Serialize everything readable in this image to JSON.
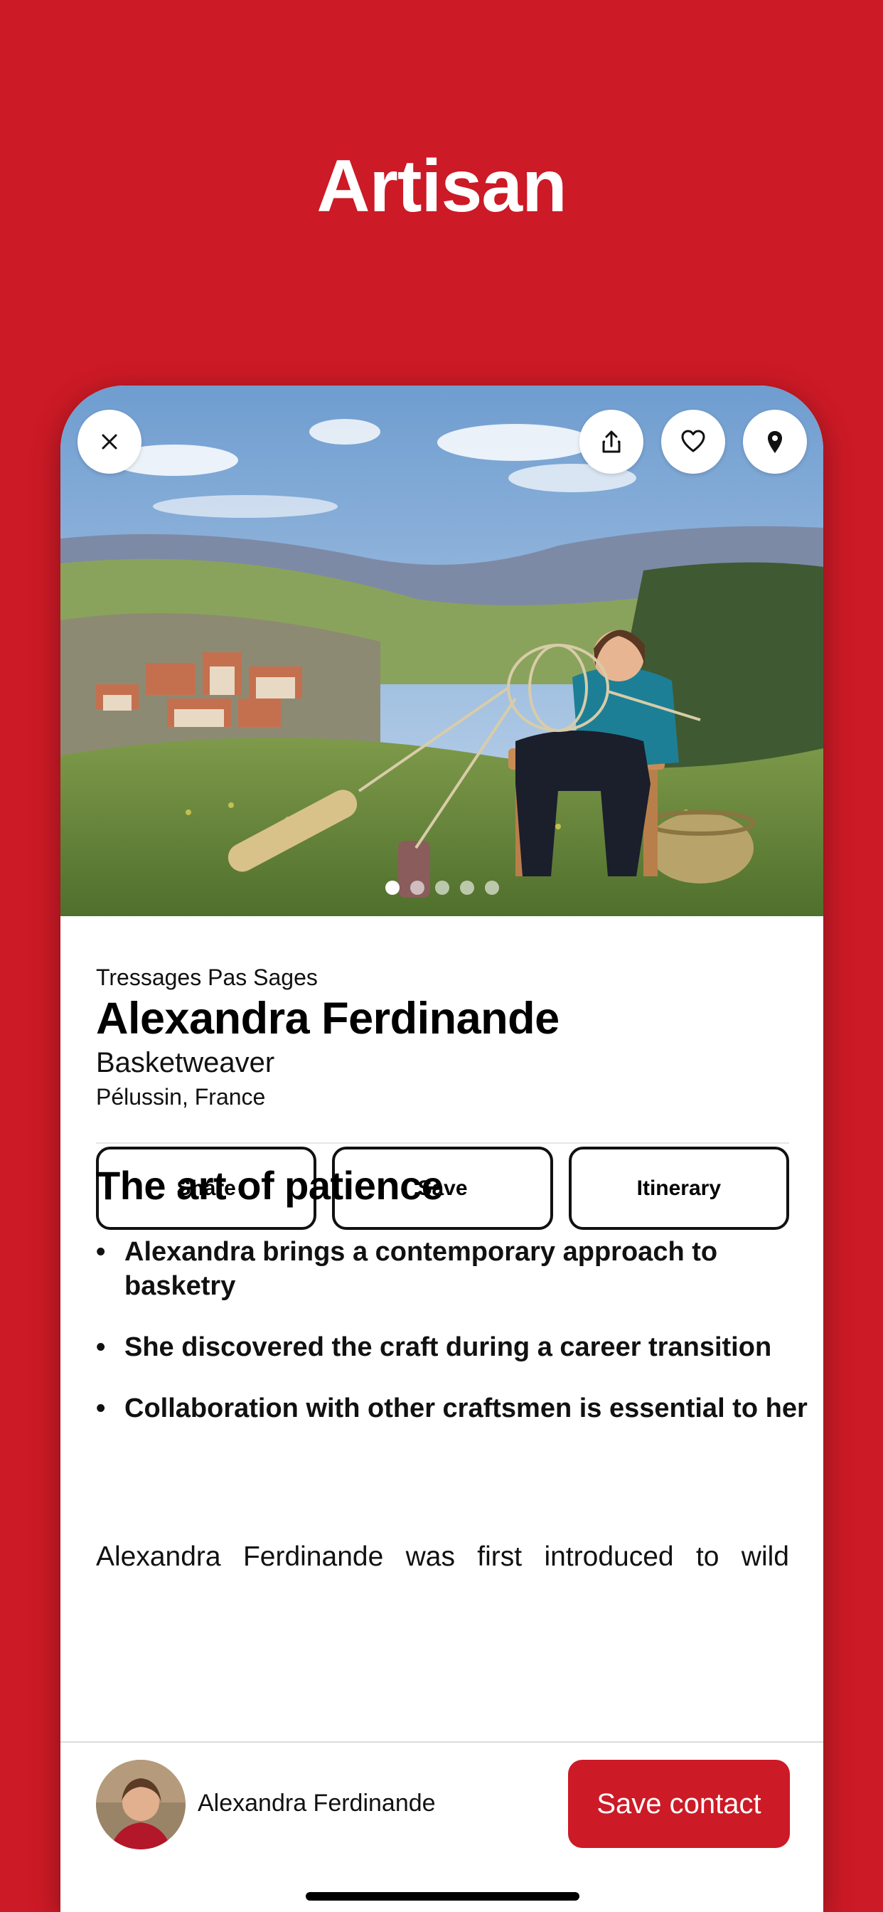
{
  "promo": {
    "title": "Artisan"
  },
  "hero": {
    "close_icon": "close-icon",
    "share_icon": "share-icon",
    "favorite_icon": "heart-icon",
    "location_icon": "map-pin-icon",
    "carousel": {
      "total": 5,
      "active": 1
    }
  },
  "profile": {
    "studio": "Tressages Pas Sages",
    "name": "Alexandra Ferdinande",
    "role": "Basketweaver",
    "location": "Pélussin, France"
  },
  "actions": {
    "share_label": "Share",
    "save_label": "Save",
    "itinerary_label": "Itinerary"
  },
  "story": {
    "title": "The art of patience",
    "bullets": [
      "Alexandra brings a contemporary approach to basketry",
      "She discovered the craft during a career transition",
      "Collaboration with other craftsmen is essential to her"
    ],
    "paragraph": "Alexandra Ferdinande was first introduced to wild"
  },
  "bottom_bar": {
    "contact_name": "Alexandra Ferdinande",
    "save_contact_label": "Save contact"
  },
  "colors": {
    "brand": "#cc1a26",
    "text": "#111111"
  }
}
